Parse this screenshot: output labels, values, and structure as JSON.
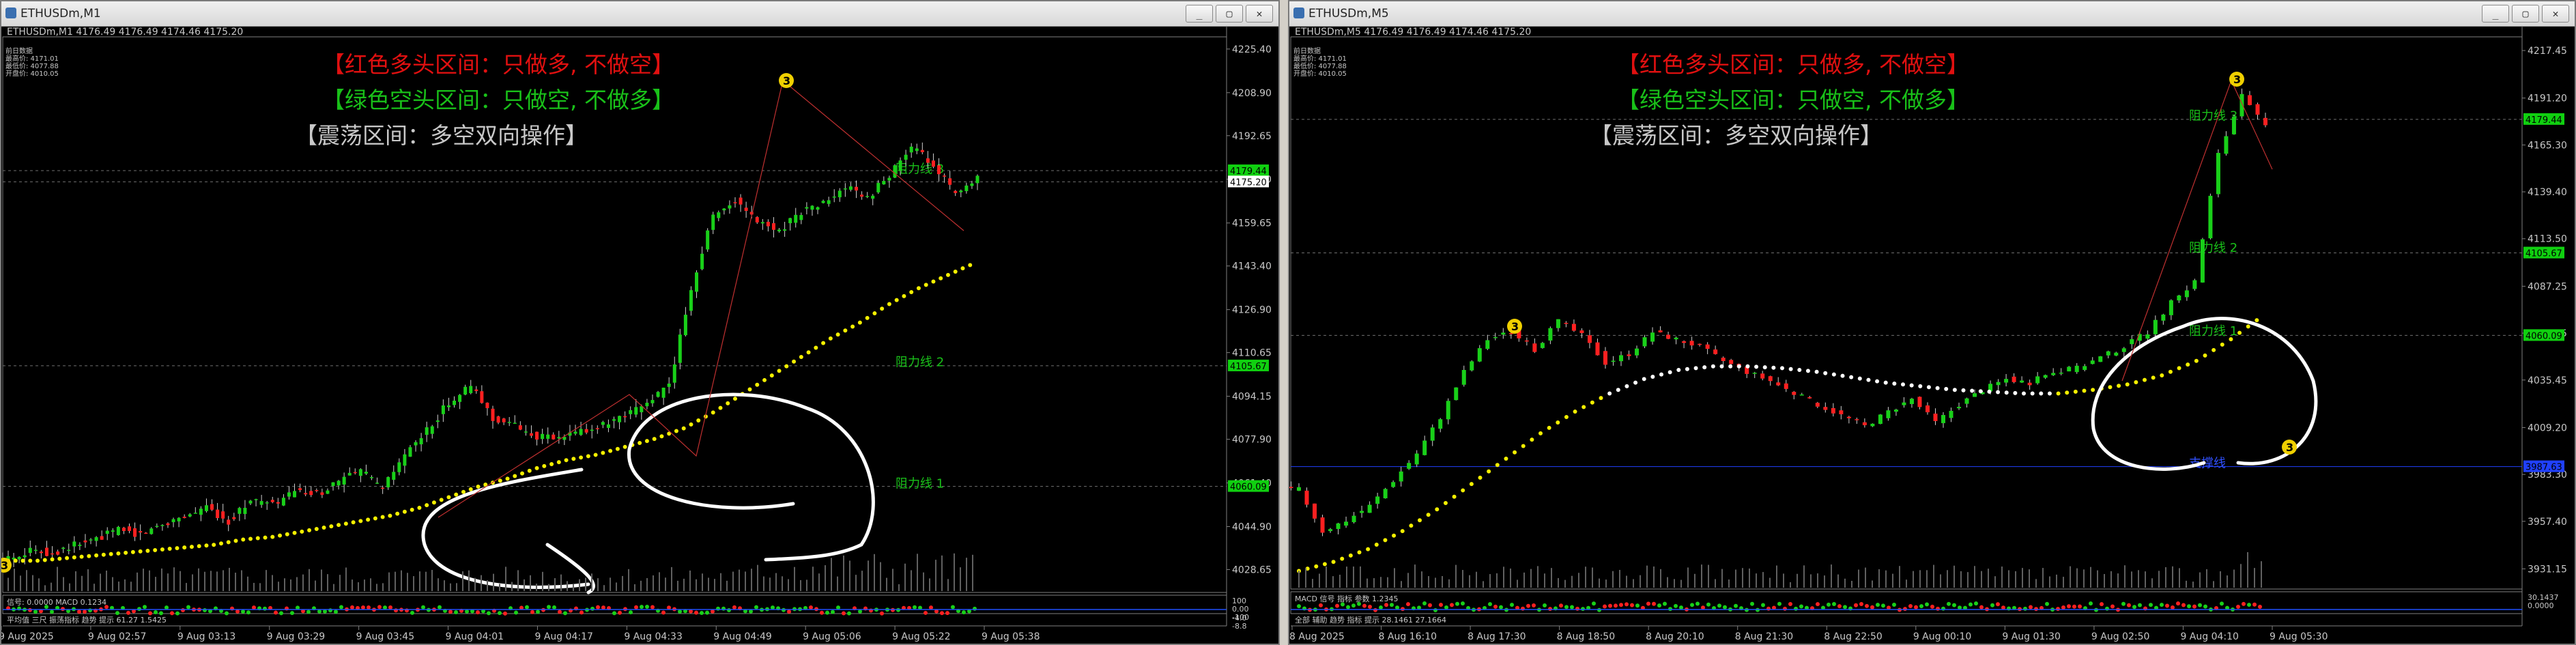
{
  "windows": [
    {
      "id": "left",
      "title": "ETHUSDm,M1",
      "buttons": [
        "_",
        "▢",
        "✕"
      ],
      "header": "ETHUSDm,M1  4176.49 4176.49 4174.46 4175.20",
      "info_lines": [
        "前日数据",
        "最高价: 4171.01",
        "最低价: 4077.88",
        "开盘价: 4010.05"
      ],
      "banners": [
        {
          "text": "【红色多头区间：只做多, 不做空】",
          "color": "#e01010"
        },
        {
          "text": "【绿色空头区间：只做空, 不做多】",
          "color": "#19c019"
        },
        {
          "text": "【震荡区间：多空双向操作】",
          "color": "#c8c8c8"
        }
      ],
      "y_ticks": [
        "4225.40",
        "4208.90",
        "4192.65",
        "4176.20",
        "4159.65",
        "4143.40",
        "4126.90",
        "4110.65",
        "4094.15",
        "4077.90",
        "4061.40",
        "4044.90",
        "4028.65"
      ],
      "x_ticks": [
        "9 Aug 2025",
        "9 Aug 02:57",
        "9 Aug 03:13",
        "9 Aug 03:29",
        "9 Aug 03:45",
        "9 Aug 04:01",
        "9 Aug 04:17",
        "9 Aug 04:33",
        "9 Aug 04:49",
        "9 Aug 05:06",
        "9 Aug 05:22",
        "9 Aug 05:38"
      ],
      "price_tags": [
        {
          "text": "4179.44",
          "value": 4179.44,
          "color": "#10d010"
        },
        {
          "text": "4175.20",
          "value": 4175.2,
          "color": "#ffffff"
        },
        {
          "text": "4105.67",
          "value": 4105.67,
          "color": "#10d010"
        },
        {
          "text": "4060.09",
          "value": 4060.09,
          "color": "#10d010"
        }
      ],
      "resistance_labels": [
        {
          "text": "阻力线 3",
          "value": 4177
        },
        {
          "text": "阻力线 2",
          "value": 4104
        },
        {
          "text": "阻力线 1",
          "value": 4058
        }
      ],
      "sub_scale": [
        "100",
        "0.00",
        "-100"
      ],
      "sub_scale2": [
        "-4.0",
        "-8.8"
      ],
      "sub_label": "信号: 0.0000 MACD 0.1234",
      "bottom_label": "平均值 三尺 振荡指标 趋势 提示 61.27 1.5425",
      "annotations": [
        "3"
      ]
    },
    {
      "id": "right",
      "title": "ETHUSDm,M5",
      "buttons": [
        "_",
        "▢",
        "✕"
      ],
      "header": "ETHUSDm,M5  4176.49 4176.49 4174.46 4175.20",
      "info_lines": [
        "前日数据",
        "最高价: 4171.01",
        "最低价: 4077.88",
        "开盘价: 4010.05"
      ],
      "banners": [
        {
          "text": "【红色多头区间：只做多, 不做空】",
          "color": "#e01010"
        },
        {
          "text": "【绿色空头区间：只做空, 不做多】",
          "color": "#19c019"
        },
        {
          "text": "【震荡区间：多空双向操作】",
          "color": "#c8c8c8"
        }
      ],
      "y_ticks": [
        "4217.45",
        "4191.20",
        "4165.30",
        "4139.40",
        "4113.50",
        "4087.25",
        "4061.35",
        "4035.45",
        "4009.20",
        "3983.30",
        "3957.40",
        "3931.15"
      ],
      "x_ticks": [
        "8 Aug 2025",
        "8 Aug 16:10",
        "8 Aug 17:30",
        "8 Aug 18:50",
        "8 Aug 20:10",
        "8 Aug 21:30",
        "8 Aug 22:50",
        "9 Aug 00:10",
        "9 Aug 01:30",
        "9 Aug 02:50",
        "9 Aug 04:10",
        "9 Aug 05:30"
      ],
      "price_tags": [
        {
          "text": "4179.44",
          "value": 4179.44,
          "color": "#10d010"
        },
        {
          "text": "4105.67",
          "value": 4105.67,
          "color": "#10d010"
        },
        {
          "text": "4060.09",
          "value": 4060.09,
          "color": "#10d010"
        },
        {
          "text": "3987.63",
          "value": 3987.63,
          "color": "#2040ff"
        }
      ],
      "resistance_labels": [
        {
          "text": "阻力线 3",
          "value": 4177
        },
        {
          "text": "阻力线 2",
          "value": 4104
        },
        {
          "text": "阻力线 1",
          "value": 4058
        },
        {
          "text": "支撑线",
          "value": 3985
        }
      ],
      "sub_scale": [
        "30.1437",
        "0.0000"
      ],
      "sub_label": "MACD 信号 指标 参数 1.2345",
      "bottom_label": "全部 辅助 趋势 指标 提示 28.1461 27.1664",
      "annotations": [
        "3",
        "3"
      ]
    }
  ],
  "chart_data": [
    {
      "type": "candlestick",
      "symbol": "ETHUSDm",
      "timeframe": "M1",
      "ylim": [
        4020,
        4230
      ],
      "x": [
        "9 Aug 2025",
        "9 Aug 02:57",
        "9 Aug 03:13",
        "9 Aug 03:29",
        "9 Aug 03:45",
        "9 Aug 04:01",
        "9 Aug 04:17",
        "9 Aug 04:33",
        "9 Aug 04:49",
        "9 Aug 05:06",
        "9 Aug 05:22",
        "9 Aug 05:38"
      ],
      "close_path": [
        4033,
        4036,
        4035,
        4038,
        4040,
        4044,
        4042,
        4046,
        4049,
        4052,
        4047,
        4055,
        4053,
        4058,
        4057,
        4062,
        4066,
        4059,
        4072,
        4081,
        4092,
        4098,
        4086,
        4083,
        4079,
        4078,
        4081,
        4083,
        4086,
        4092,
        4098,
        4135,
        4163,
        4168,
        4160,
        4157,
        4164,
        4167,
        4173,
        4169,
        4178,
        4188,
        4182,
        4170,
        4176
      ],
      "ma_series": [
        4032,
        4032,
        4033,
        4034,
        4035,
        4036,
        4037,
        4038,
        4040,
        4041,
        4043,
        4045,
        4047,
        4049,
        4052,
        4056,
        4060,
        4063,
        4067,
        4070,
        4072,
        4075,
        4078,
        4082,
        4088,
        4095,
        4102,
        4109,
        4116,
        4122,
        4129,
        4135,
        4140,
        4145
      ],
      "horizontal_levels": [
        4179.44,
        4175.2,
        4105.67,
        4060.09
      ]
    },
    {
      "type": "candlestick",
      "symbol": "ETHUSDm",
      "timeframe": "M5",
      "ylim": [
        3920,
        4225
      ],
      "x": [
        "8 Aug 2025",
        "8 Aug 16:10",
        "8 Aug 17:30",
        "8 Aug 18:50",
        "8 Aug 20:10",
        "8 Aug 21:30",
        "8 Aug 22:50",
        "9 Aug 00:10",
        "9 Aug 01:30",
        "9 Aug 02:50",
        "9 Aug 04:10",
        "9 Aug 05:30"
      ],
      "close_path": [
        3975,
        3952,
        3958,
        3966,
        3980,
        3995,
        4015,
        4040,
        4058,
        4062,
        4052,
        4068,
        4060,
        4045,
        4050,
        4062,
        4058,
        4054,
        4046,
        4040,
        4035,
        4028,
        4022,
        4016,
        4010,
        4018,
        4025,
        4012,
        4022,
        4030,
        4036,
        4034,
        4040,
        4042,
        4048,
        4054,
        4062,
        4078,
        4090,
        4160,
        4192,
        4175
      ],
      "ma_series": [
        3930,
        3935,
        3942,
        3952,
        3964,
        3978,
        3992,
        4006,
        4018,
        4028,
        4036,
        4041,
        4043,
        4043,
        4042,
        4040,
        4037,
        4034,
        4032,
        4030,
        4029,
        4028,
        4028,
        4030,
        4033,
        4038,
        4046,
        4058,
        4072
      ],
      "horizontal_levels": [
        4179.44,
        4105.67,
        4060.09,
        3987.63
      ]
    }
  ]
}
